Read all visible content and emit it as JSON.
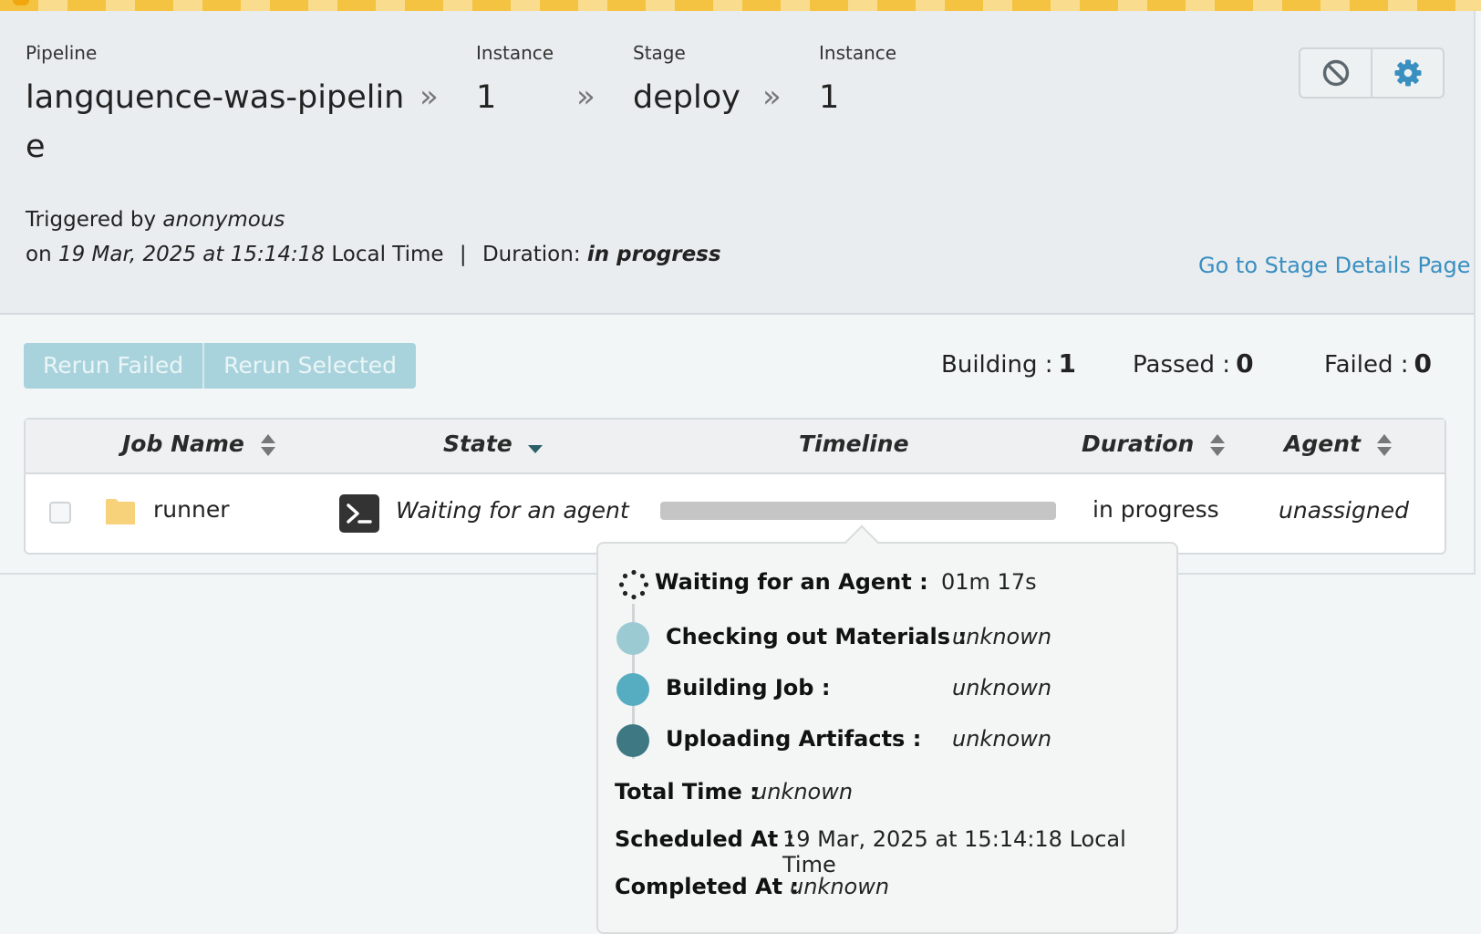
{
  "breadcrumb": {
    "pipeline_label": "Pipeline",
    "pipeline_name_line1": "langquence-was-pipelin",
    "pipeline_name_line2": "e",
    "instance_label": "Instance",
    "instance_value": "1",
    "stage_label": "Stage",
    "stage_value": "deploy",
    "stage_instance_label": "Instance",
    "stage_instance_value": "1",
    "separator": "»"
  },
  "trigger": {
    "prefix": "Triggered by",
    "user": "anonymous",
    "on": "on",
    "date": "19 Mar, 2025 at 15:14:18",
    "local_time": "Local Time",
    "divider": "|",
    "duration_label": "Duration:",
    "duration_value": "in progress"
  },
  "stage_link": "Go to Stage Details Page",
  "actions": {
    "rerun_failed": "Rerun Failed",
    "rerun_selected": "Rerun Selected"
  },
  "counts": {
    "building_label": "Building :",
    "building": "1",
    "passed_label": "Passed :",
    "passed": "0",
    "failed_label": "Failed :",
    "failed": "0"
  },
  "table": {
    "headers": {
      "job_name": "Job Name",
      "state": "State",
      "timeline": "Timeline",
      "duration": "Duration",
      "agent": "Agent"
    },
    "rows": [
      {
        "job_name": "runner",
        "state": "Waiting for an agent",
        "duration": "in progress",
        "agent": "unassigned"
      }
    ]
  },
  "popup": {
    "waiting_label": "Waiting for an Agent :",
    "waiting_value": "01m 17s",
    "checkout_label": "Checking out Materials :",
    "checkout_value": "unknown",
    "building_label": "Building Job :",
    "building_value": "unknown",
    "uploading_label": "Uploading Artifacts :",
    "uploading_value": "unknown",
    "total_label": "Total Time :",
    "total_value": "unknown",
    "scheduled_label": "Scheduled At :",
    "scheduled_value": "19 Mar, 2025 at 15:14:18 Local Time",
    "completed_label": "Completed At :",
    "completed_value": "unknown"
  },
  "colors": {
    "link": "#3a8fc1",
    "checkout_dot": "#9ccad3",
    "building_dot": "#56adc1",
    "uploading_dot": "#3d7883",
    "rerun_button": "#a9d3dc",
    "stripe": "#f5c342"
  },
  "icons": {
    "header_left": "cancel-icon",
    "header_right": "gear-icon",
    "sort": "sort-icon",
    "state_sort": "caret-down-icon",
    "job_folder": "folder-icon",
    "job_console": "terminal-icon",
    "waiting": "spinner-icon"
  }
}
